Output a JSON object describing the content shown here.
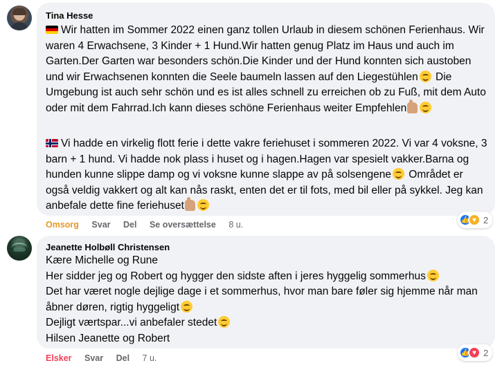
{
  "comments": [
    {
      "author": "Tina Hesse",
      "paragraph_de": "Wir hatten im Sommer 2022 einen ganz tollen Urlaub in diesem schönen Ferienhaus. Wir waren 4 Erwachsene, 3 Kinder + 1 Hund.Wir hatten genug Platz im Haus und auch im Garten.Der Garten war besonders schön.Die Kinder und der Hund konnten sich austoben und wir Erwachsenen konnten die Seele baumeln lassen auf den Liegestühlen",
      "paragraph_de_2": " Die Umgebung ist auch sehr schön und es ist alles schnell zu erreichen ob zu Fuß, mit dem Auto oder mit dem Fahrrad.Ich kann dieses schöne Ferienhaus weiter Empfehlen",
      "paragraph_no": "Vi hadde en virkelig flott ferie i dette vakre feriehuset i sommeren 2022. Vi var 4 voksne, 3 barn + 1 hund. Vi hadde nok plass i huset og i hagen.Hagen var spesielt vakker.Barna og hunden kunne slippe damp og vi voksne kunne slappe av på solsengene",
      "paragraph_no_2": " Området er også veldig vakkert og alt kan nås raskt, enten det er til fots, med bil eller på sykkel. Jeg kan anbefale dette fine feriehuset",
      "actions": {
        "reaction_label": "Omsorg",
        "reply_label": "Svar",
        "share_label": "Del",
        "translate_label": "Se oversættelse",
        "time": "8 u."
      },
      "reaction_count": "2",
      "reaction_icons": [
        "like-icon",
        "care-icon"
      ]
    },
    {
      "author": "Jeanette Holbøll Christensen",
      "lines": [
        "Kære Michelle og Rune",
        "Her sidder jeg og Robert og hygger den sidste aften i jeres hyggelig sommerhus",
        "Det har været nogle dejlige dage i et sommerhus, hvor man bare føler sig hjemme når man åbner døren, rigtig hyggeligt",
        "Dejligt værtspar...vi anbefaler stedet",
        "Hilsen Jeanette og Robert"
      ],
      "actions": {
        "reaction_label": "Elsker",
        "reply_label": "Svar",
        "share_label": "Del",
        "time": "7 u."
      },
      "reaction_count": "2",
      "reaction_icons": [
        "like-icon",
        "love-icon"
      ]
    }
  ],
  "colors": {
    "bubble": "#f0f2f5",
    "meta_text": "#65676b",
    "care_orange": "#e4982a",
    "love_red": "#f33e58",
    "like_blue": "#1877f2"
  }
}
